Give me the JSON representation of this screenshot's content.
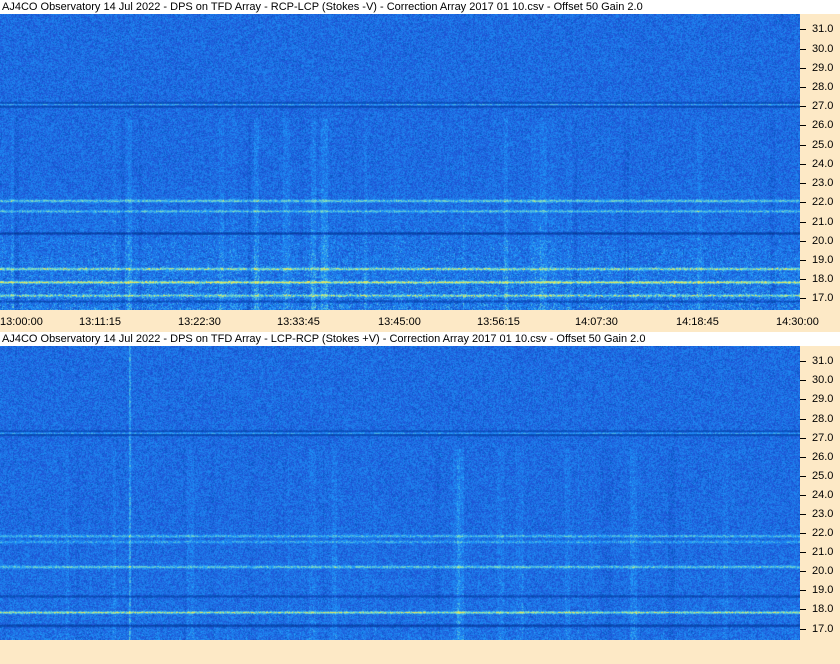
{
  "panels": [
    {
      "title": "AJ4CO Observatory 14 Jul 2022  -  DPS on TFD Array  -  RCP-LCP (Stokes -V)  -  Correction Array 2017 01 10.csv  -  Offset 50  Gain 2.0"
    },
    {
      "title": "AJ4CO Observatory 14 Jul 2022  -  DPS on TFD Array  -  LCP-RCP (Stokes +V)  -  Correction Array 2017 01 10.csv  -  Offset 50  Gain 2.0"
    }
  ],
  "time_labels": [
    "13:00:00",
    "13:11:15",
    "13:22:30",
    "13:33:45",
    "13:45:00",
    "13:56:15",
    "14:07:30",
    "14:18:45",
    "14:30:00"
  ],
  "freq_labels": [
    "31.0",
    "30.0",
    "29.0",
    "28.0",
    "27.0",
    "26.0",
    "25.0",
    "24.0",
    "23.0",
    "22.0",
    "21.0",
    "20.0",
    "19.0",
    "18.0",
    "17.0"
  ],
  "colors": {
    "background": "#fde9c6",
    "spectrogram_base": "#1f4fd8"
  },
  "chart_data": [
    {
      "type": "heatmap",
      "title": "AJ4CO Observatory 14 Jul 2022  -  DPS on TFD Array  -  RCP-LCP (Stokes -V)  -  Correction Array 2017 01 10.csv  -  Offset 50  Gain 2.0",
      "x": [
        "13:00:00",
        "13:11:15",
        "13:22:30",
        "13:33:45",
        "13:45:00",
        "13:56:15",
        "14:07:30",
        "14:18:45",
        "14:30:00"
      ],
      "y_ticks": [
        31.0,
        30.0,
        29.0,
        28.0,
        27.0,
        26.0,
        25.0,
        24.0,
        23.0,
        22.0,
        21.0,
        20.0,
        19.0,
        18.0,
        17.0
      ],
      "ylim": [
        16.4,
        31.8
      ],
      "xlabel": "",
      "ylabel": ""
    },
    {
      "type": "heatmap",
      "title": "AJ4CO Observatory 14 Jul 2022  -  DPS on TFD Array  -  LCP-RCP (Stokes +V)  -  Correction Array 2017 01 10.csv  -  Offset 50  Gain 2.0",
      "x": [
        "13:00:00",
        "13:11:15",
        "13:22:30",
        "13:33:45",
        "13:45:00",
        "13:56:15",
        "14:07:30",
        "14:18:45",
        "14:30:00"
      ],
      "y_ticks": [
        31.0,
        30.0,
        29.0,
        28.0,
        27.0,
        26.0,
        25.0,
        24.0,
        23.0,
        22.0,
        21.0,
        20.0,
        19.0,
        18.0,
        17.0
      ],
      "ylim": [
        16.4,
        31.8
      ],
      "xlabel": "",
      "ylabel": ""
    }
  ]
}
